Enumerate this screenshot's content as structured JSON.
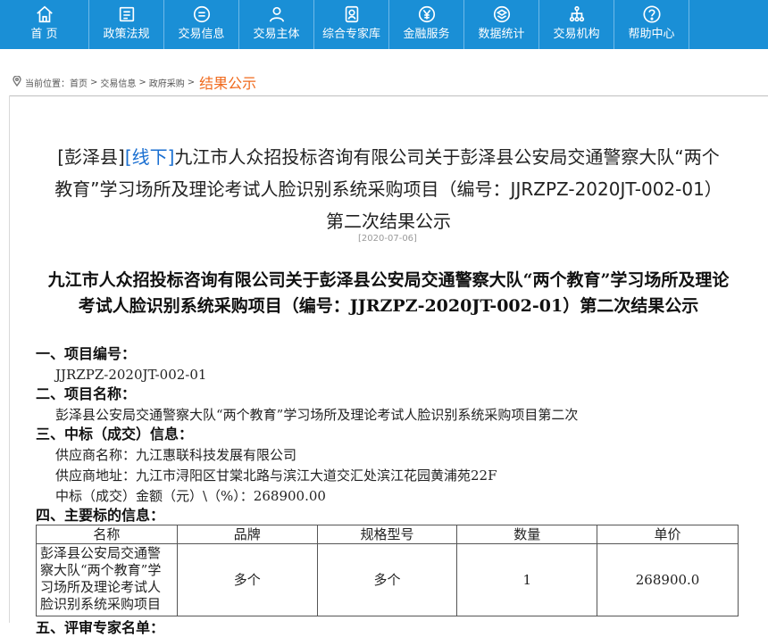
{
  "nav": {
    "items": [
      {
        "label": "首 页",
        "icon": "home-icon"
      },
      {
        "label": "政策法规",
        "icon": "document-icon"
      },
      {
        "label": "交易信息",
        "icon": "list-circle-icon"
      },
      {
        "label": "交易主体",
        "icon": "user-icon"
      },
      {
        "label": "综合专家库",
        "icon": "expert-badge-icon"
      },
      {
        "label": "金融服务",
        "icon": "yen-icon"
      },
      {
        "label": "数据统计",
        "icon": "layers-icon"
      },
      {
        "label": "交易机构",
        "icon": "org-chart-icon"
      },
      {
        "label": "帮助中心",
        "icon": "help-icon"
      }
    ],
    "bg_color": "#1a8fd6"
  },
  "breadcrumb": {
    "prefix": "当前位置：",
    "items": [
      "首页",
      "交易信息",
      "政府采购"
    ],
    "separator": ">",
    "current": "结果公示",
    "current_color": "#f06a1d"
  },
  "notice": {
    "title_tag1": "[彭泽县]",
    "title_tag2": "[线下]",
    "title_text": "九江市人众招投标咨询有限公司关于彭泽县公安局交通警察大队“两个教育”学习场所及理论考试人脸识别系统采购项目（编号：JJRZPZ-2020JT-002-01）第二次结果公示",
    "date": "[2020-07-06]",
    "heading": "九江市人众招投标咨询有限公司关于彭泽县公安局交通警察大队“两个教育”学习场所及理论考试人脸识别系统采购项目（编号：JJRZPZ-2020JT-002-01）第二次结果公示",
    "sections": {
      "s1_title": "一、项目编号：",
      "s1_value": "JJRZPZ-2020JT-002-01",
      "s2_title": "二、项目名称：",
      "s2_value": "彭泽县公安局交通警察大队“两个教育”学习场所及理论考试人脸识别系统采购项目第二次",
      "s3_title": "三、中标（成交）信息：",
      "s3_supplier": "供应商名称：九江惠联科技发展有限公司",
      "s3_address": "供应商地址：九江市浔阳区甘棠北路与滨江大道交汇处滨江花园黄浦苑22F",
      "s3_amount": "中标（成交）金额（元）\\（%）：268900.00",
      "s4_title": "四、主要标的信息：",
      "s5_title": "五、评审专家名单："
    },
    "table": {
      "headers": [
        "名称",
        "品牌",
        "规格型号",
        "数量",
        "单价"
      ],
      "rows": [
        [
          "彭泽县公安局交通警察大队“两个教育”学习场所及理论考试人脸识别系统采购项目",
          "多个",
          "多个",
          "1",
          "268900.0"
        ]
      ]
    }
  }
}
